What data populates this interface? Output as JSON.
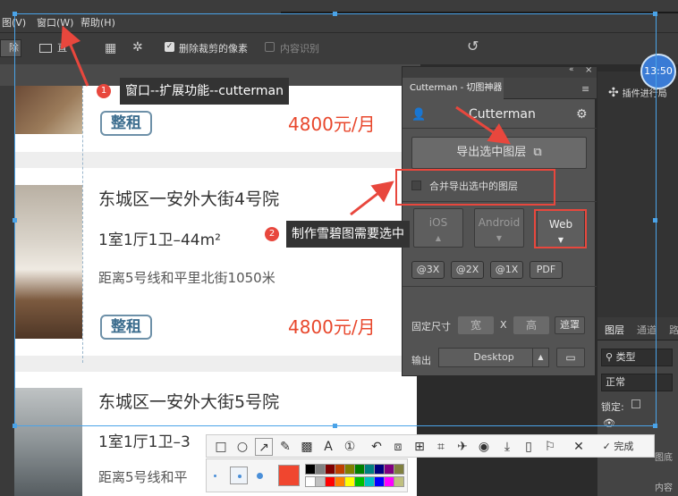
{
  "menu": {
    "item1": "图(V)",
    "window": "窗口(W)",
    "help": "帮助(H)"
  },
  "options": {
    "btn1": "除",
    "btn2": "直",
    "delete_crop_pixels": "删除裁剪的像素",
    "content_aware": "内容识别"
  },
  "listings": [
    {
      "tag": "整租",
      "price": "4800元/月"
    },
    {
      "title": "东城区一安外大街4号院",
      "layout": "1室1厅1卫–44m²",
      "distance": "距离5号线和平里北街1050米",
      "tag": "整租",
      "price": "4800元/月"
    },
    {
      "title": "东城区一安外大街5号院",
      "layout": "1室1厅1卫–3",
      "distance": "距离5号线和平"
    }
  ],
  "annotations": {
    "note1_number": "1",
    "note1_text": "窗口--扩展功能--cutterman",
    "note2_number": "2",
    "note2_text": "制作雪碧图需要选中"
  },
  "cutterman": {
    "tab_label": "Cutterman - 切图神器",
    "brand": "Cutterman",
    "export_button": "导出选中图层",
    "merge_checkbox": "合并导出选中的图层",
    "platforms": [
      "iOS",
      "Android",
      "Web"
    ],
    "scales": [
      "@3X",
      "@2X",
      "@1X",
      "PDF"
    ],
    "fixed_size_label": "固定尺寸",
    "width_placeholder": "宽",
    "x_label": "X",
    "height_placeholder": "高",
    "mask_button": "遮罩",
    "output_label": "输出",
    "output_value": "Desktop"
  },
  "rightpanel": {
    "plugin_text": "插件进行局",
    "clock": "13:50",
    "tabs": [
      "图层",
      "通道",
      "路"
    ],
    "kind_label": "类型",
    "blend_mode": "正常",
    "lock_label": "锁定:",
    "layer_label": "图底",
    "layer2_label": "内容"
  },
  "toolbar": {
    "done_label": "完成"
  },
  "colors": {
    "accent_red": "#e8473d",
    "price_red": "#e8472c",
    "selection_blue": "#4aa3e8",
    "tag_blue": "#3d6e8f",
    "current_color": "#f0462f",
    "palette": [
      "#000000",
      "#808080",
      "#800000",
      "#c04000",
      "#808000",
      "#008000",
      "#008080",
      "#000080",
      "#800080",
      "#808040",
      "#ffffff",
      "#c0c0c0",
      "#ff0000",
      "#ff8000",
      "#ffff00",
      "#00c000",
      "#00c0c0",
      "#0000ff",
      "#ff00ff",
      "#c0c080"
    ]
  }
}
